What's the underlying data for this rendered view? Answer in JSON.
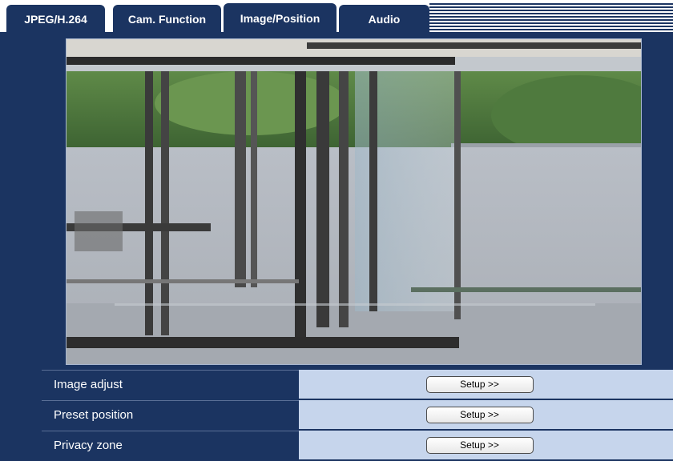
{
  "tabs": [
    {
      "label": "JPEG/H.264",
      "active": false
    },
    {
      "label": "Cam. Function",
      "active": false
    },
    {
      "label": "Image/Position",
      "active": true
    },
    {
      "label": "Audio",
      "active": false
    }
  ],
  "colors": {
    "background": "#1b3461",
    "row_value_bg": "#c6d5ec"
  },
  "settings": {
    "rows": [
      {
        "label": "Image adjust",
        "button": "Setup >>"
      },
      {
        "label": "Preset position",
        "button": "Setup >>"
      },
      {
        "label": "Privacy zone",
        "button": "Setup >>"
      }
    ]
  }
}
